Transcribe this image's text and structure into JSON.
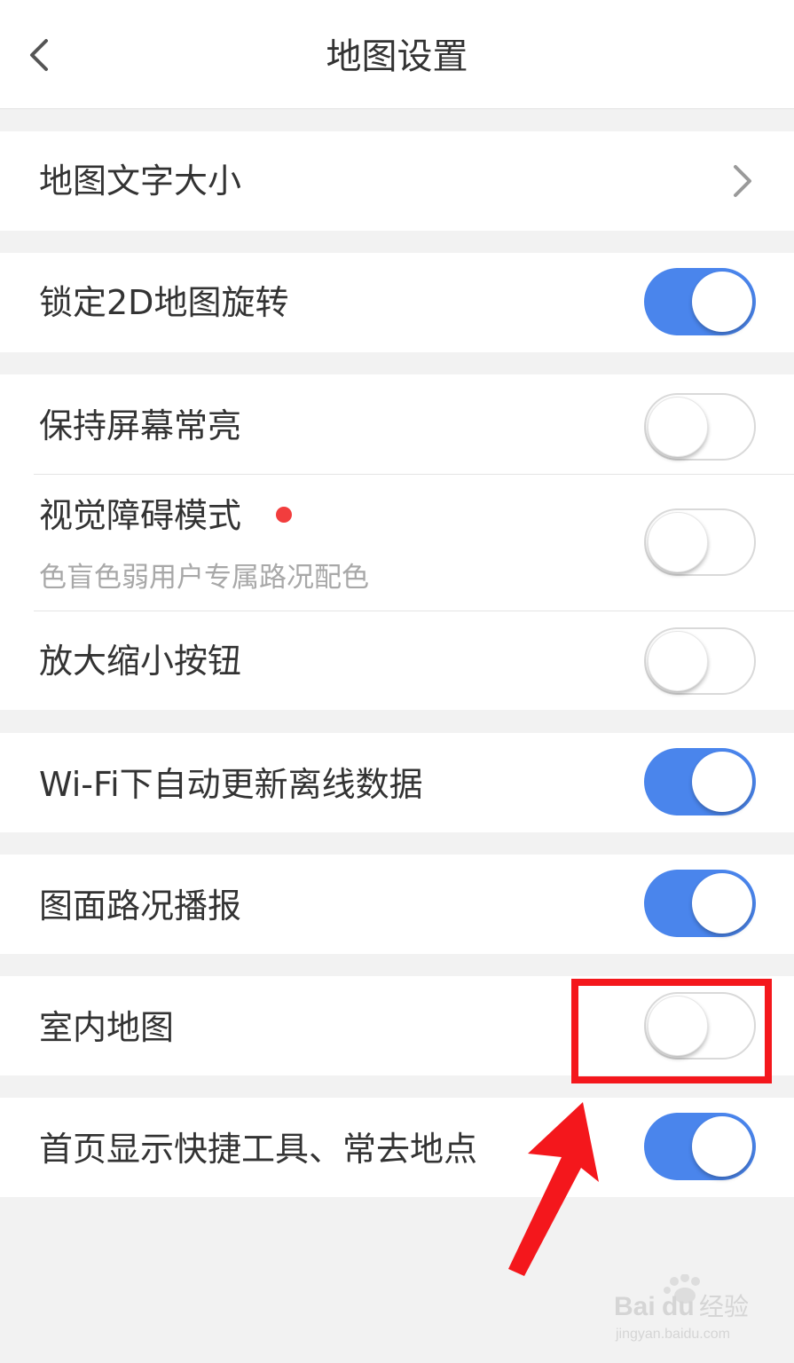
{
  "header": {
    "title": "地图设置",
    "back_icon": "chevron-left-icon"
  },
  "sections": [
    {
      "rows": [
        {
          "label": "地图文字大小",
          "control": "chevron-right-icon"
        }
      ]
    },
    {
      "rows": [
        {
          "label": "锁定2D地图旋转",
          "toggle": "on"
        }
      ]
    },
    {
      "rows": [
        {
          "label": "保持屏幕常亮",
          "toggle": "off"
        },
        {
          "label": "视觉障碍模式",
          "sublabel": "色盲色弱用户专属路况配色",
          "new_badge": true,
          "toggle": "off"
        },
        {
          "label": "放大缩小按钮",
          "toggle": "off"
        }
      ]
    },
    {
      "rows": [
        {
          "label": "Wi-Fi下自动更新离线数据",
          "toggle": "on"
        }
      ]
    },
    {
      "rows": [
        {
          "label": "图面路况播报",
          "toggle": "on"
        }
      ]
    },
    {
      "rows": [
        {
          "label": "室内地图",
          "toggle": "off"
        }
      ]
    },
    {
      "rows": [
        {
          "label": "首页显示快捷工具、常去地点",
          "toggle": "on"
        }
      ]
    }
  ],
  "colors": {
    "toggle_on": "#4a85ec",
    "new_badge": "#f23d3d",
    "annotation": "#f4171c"
  },
  "watermark": {
    "brand": "Bai",
    "brand2": "du",
    "suffix": "经验",
    "url": "jingyan.baidu.com"
  }
}
